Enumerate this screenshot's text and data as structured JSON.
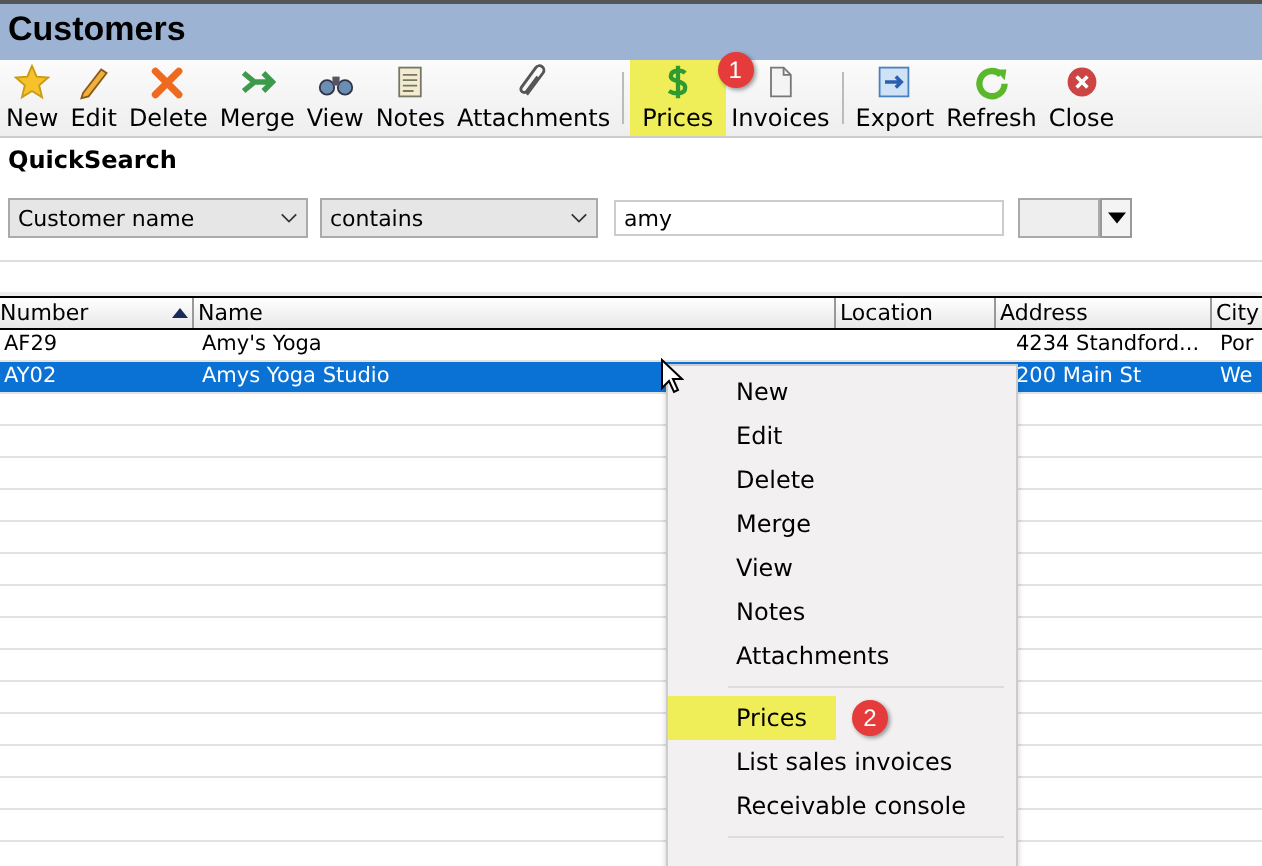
{
  "window": {
    "title": "Customers"
  },
  "toolbar": [
    {
      "kind": "button",
      "label": "New",
      "highlighted": false
    },
    {
      "kind": "button",
      "label": "Edit",
      "highlighted": false
    },
    {
      "kind": "button",
      "label": "Delete",
      "highlighted": false
    },
    {
      "kind": "button",
      "label": "Merge",
      "highlighted": false
    },
    {
      "kind": "button",
      "label": "View",
      "highlighted": false
    },
    {
      "kind": "button",
      "label": "Notes",
      "highlighted": false
    },
    {
      "kind": "button",
      "label": "Attachments",
      "highlighted": false
    },
    {
      "kind": "separator"
    },
    {
      "kind": "button",
      "label": "Prices",
      "highlighted": true,
      "badge": "1"
    },
    {
      "kind": "button",
      "label": "Invoices",
      "highlighted": false
    },
    {
      "kind": "separator"
    },
    {
      "kind": "button",
      "label": "Export",
      "highlighted": false
    },
    {
      "kind": "button",
      "label": "Refresh",
      "highlighted": false
    },
    {
      "kind": "button",
      "label": "Close",
      "highlighted": false
    }
  ],
  "quicksearch": {
    "title": "QuickSearch",
    "field": "Customer name",
    "operator": "contains",
    "value": "amy"
  },
  "table": {
    "columns": [
      {
        "label": "Number",
        "sorted": true
      },
      {
        "label": "Name",
        "sorted": false
      },
      {
        "label": "Location",
        "sorted": false
      },
      {
        "label": "Address",
        "sorted": false
      },
      {
        "label": "City",
        "sorted": false
      }
    ],
    "rows": [
      {
        "selected": false,
        "cells": [
          "AF29",
          "Amy's Yoga",
          "",
          "4234 Standford...",
          "Por"
        ]
      },
      {
        "selected": true,
        "cells": [
          "AY02",
          "Amys Yoga Studio",
          "",
          "200 Main St",
          "We"
        ]
      }
    ]
  },
  "context_menu": [
    {
      "kind": "item",
      "label": "New",
      "highlighted": false
    },
    {
      "kind": "item",
      "label": "Edit",
      "highlighted": false
    },
    {
      "kind": "item",
      "label": "Delete",
      "highlighted": false
    },
    {
      "kind": "item",
      "label": "Merge",
      "highlighted": false
    },
    {
      "kind": "item",
      "label": "View",
      "highlighted": false
    },
    {
      "kind": "item",
      "label": "Notes",
      "highlighted": false
    },
    {
      "kind": "item",
      "label": "Attachments",
      "highlighted": false
    },
    {
      "kind": "separator"
    },
    {
      "kind": "item",
      "label": "Prices",
      "highlighted": true,
      "badge": "2"
    },
    {
      "kind": "item",
      "label": "List sales invoices",
      "highlighted": false
    },
    {
      "kind": "item",
      "label": "Receivable console",
      "highlighted": false
    },
    {
      "kind": "separator"
    }
  ]
}
